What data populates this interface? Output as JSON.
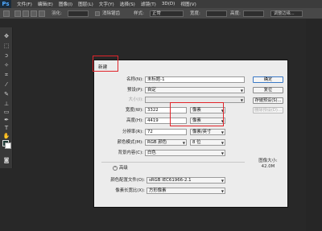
{
  "app": {
    "logo": "Ps"
  },
  "menu": [
    "文件(F)",
    "编辑(E)",
    "图像(I)",
    "图层(L)",
    "文字(Y)",
    "选择(S)",
    "滤镜(T)",
    "3D(D)",
    "视图(V)"
  ],
  "options_bar": {
    "feather_label": "羽化:",
    "antialias_label": "消除锯齿",
    "style_label": "样式:",
    "style_value": "正常",
    "width_label": "宽度:",
    "height_label": "高度:",
    "refine_label": "调整边缘..."
  },
  "dialog": {
    "title": "新建",
    "name_label": "名称(N):",
    "name_value": "未标题-1",
    "preset_label": "预设(P):",
    "preset_value": "自定",
    "size_label": "大小(I):",
    "width_label": "宽度(W):",
    "width_value": "3322",
    "width_unit": "像素",
    "height_label": "高度(H):",
    "height_value": "4419",
    "height_unit": "像素",
    "resolution_label": "分辨率(R):",
    "resolution_value": "72",
    "resolution_unit": "像素/英寸",
    "color_mode_label": "颜色模式(M):",
    "color_mode_value": "RGB 颜色",
    "bit_depth": "8 位",
    "background_label": "背景内容(C):",
    "background_value": "白色",
    "advanced_label": "高级",
    "profile_label": "颜色配置文件(O):",
    "profile_value": "sRGB IEC61966-2.1",
    "pixel_aspect_label": "像素长宽比(X):",
    "pixel_aspect_value": "方形像素",
    "buttons": {
      "ok": "确定",
      "reset": "复位",
      "save_preset": "存储预设(S)...",
      "delete_preset": "删除预设(D)..."
    },
    "image_size_label": "图像大小:",
    "image_size_value": "42.0M"
  }
}
